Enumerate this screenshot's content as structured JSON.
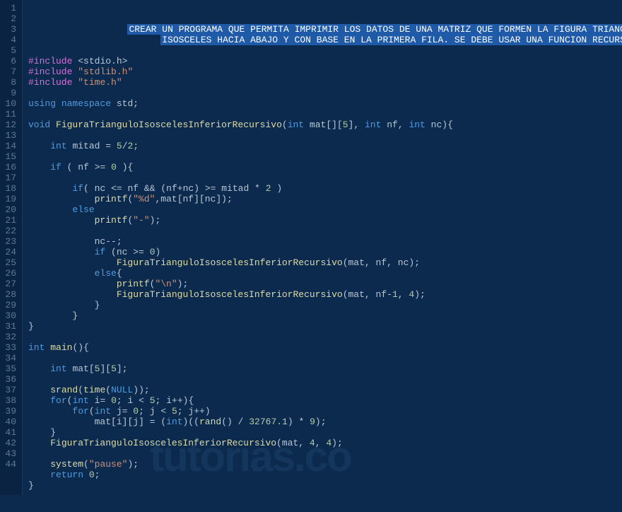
{
  "watermark": "tutorias.co",
  "gutter": [
    "1",
    "2",
    "3",
    "4",
    "5",
    "6",
    "7",
    "8",
    "9",
    "10",
    "11",
    "12",
    "13",
    "14",
    "15",
    "16",
    "17",
    "18",
    "19",
    "20",
    "21",
    "22",
    "23",
    "24",
    "25",
    "26",
    "27",
    "28",
    "29",
    "30",
    "31",
    "32",
    "33",
    "34",
    "35",
    "36",
    "37",
    "38",
    "39",
    "40",
    "41",
    "42",
    "43",
    "44"
  ],
  "lines": [
    {
      "type": "sel",
      "indent": "                  ",
      "text": "CREAR·UN·PROGRAMA·QUE·PERMITA·IMPRIMIR·LOS·DATOS·DE·UNA·MATRIZ·QUE·FORMEN·LA·FIGURA·TRIANGULO"
    },
    {
      "type": "sel",
      "indent": "                        ",
      "text": "ISOSCELES·HACIA·ABAJO·Y·CON·BASE·EN·LA·PRIMERA·FILA.·SE·DEBE·USAR·UNA·FUNCION·RECURSIVA"
    },
    {
      "type": "blank"
    },
    {
      "type": "include",
      "header": "<stdio.h>",
      "angle": true
    },
    {
      "type": "include",
      "header": "\"stdlib.h\"",
      "angle": false
    },
    {
      "type": "include",
      "header": "\"time.h\"",
      "angle": false
    },
    {
      "type": "blank"
    },
    {
      "type": "code",
      "tokens": [
        [
          "keyword",
          "using"
        ],
        [
          "ws",
          " "
        ],
        [
          "keyword",
          "namespace"
        ],
        [
          "ws",
          " "
        ],
        [
          "ident",
          "std"
        ],
        [
          "op",
          ";"
        ]
      ]
    },
    {
      "type": "blank"
    },
    {
      "type": "code",
      "tokens": [
        [
          "keyword",
          "void"
        ],
        [
          "ws",
          " "
        ],
        [
          "func",
          "FiguraTrianguloIsoscelesInferiorRecursivo"
        ],
        [
          "paren",
          "("
        ],
        [
          "keyword",
          "int"
        ],
        [
          "ws",
          " "
        ],
        [
          "ident",
          "mat"
        ],
        [
          "paren",
          "[]["
        ],
        [
          "num",
          "5"
        ],
        [
          "paren",
          "]"
        ],
        [
          "op",
          ","
        ],
        [
          "ws",
          " "
        ],
        [
          "keyword",
          "int"
        ],
        [
          "ws",
          " "
        ],
        [
          "ident",
          "nf"
        ],
        [
          "op",
          ","
        ],
        [
          "ws",
          " "
        ],
        [
          "keyword",
          "int"
        ],
        [
          "ws",
          " "
        ],
        [
          "ident",
          "nc"
        ],
        [
          "paren",
          ")"
        ],
        [
          "paren",
          "{"
        ]
      ]
    },
    {
      "type": "blank"
    },
    {
      "type": "code",
      "indent": "    ",
      "tokens": [
        [
          "keyword",
          "int"
        ],
        [
          "ws",
          " "
        ],
        [
          "ident",
          "mitad"
        ],
        [
          "ws",
          " "
        ],
        [
          "op",
          "="
        ],
        [
          "ws",
          " "
        ],
        [
          "num",
          "5"
        ],
        [
          "op",
          "/"
        ],
        [
          "num",
          "2"
        ],
        [
          "op",
          ";"
        ]
      ]
    },
    {
      "type": "blank"
    },
    {
      "type": "code",
      "indent": "    ",
      "tokens": [
        [
          "keyword",
          "if"
        ],
        [
          "ws",
          " "
        ],
        [
          "paren",
          "("
        ],
        [
          "ws",
          " "
        ],
        [
          "ident",
          "nf"
        ],
        [
          "ws",
          " "
        ],
        [
          "op",
          ">="
        ],
        [
          "ws",
          " "
        ],
        [
          "num",
          "0"
        ],
        [
          "ws",
          " "
        ],
        [
          "paren",
          ")"
        ],
        [
          "paren",
          "{"
        ]
      ]
    },
    {
      "type": "blank"
    },
    {
      "type": "code",
      "indent": "        ",
      "tokens": [
        [
          "keyword",
          "if"
        ],
        [
          "paren",
          "("
        ],
        [
          "ws",
          " "
        ],
        [
          "ident",
          "nc"
        ],
        [
          "ws",
          " "
        ],
        [
          "op",
          "<="
        ],
        [
          "ws",
          " "
        ],
        [
          "ident",
          "nf"
        ],
        [
          "ws",
          " "
        ],
        [
          "op",
          "&&"
        ],
        [
          "ws",
          " "
        ],
        [
          "paren",
          "("
        ],
        [
          "ident",
          "nf"
        ],
        [
          "op",
          "+"
        ],
        [
          "ident",
          "nc"
        ],
        [
          "paren",
          ")"
        ],
        [
          "ws",
          " "
        ],
        [
          "op",
          ">="
        ],
        [
          "ws",
          " "
        ],
        [
          "ident",
          "mitad"
        ],
        [
          "ws",
          " "
        ],
        [
          "op",
          "*"
        ],
        [
          "ws",
          " "
        ],
        [
          "num",
          "2"
        ],
        [
          "ws",
          " "
        ],
        [
          "paren",
          ")"
        ]
      ]
    },
    {
      "type": "code",
      "indent": "            ",
      "tokens": [
        [
          "func",
          "printf"
        ],
        [
          "paren",
          "("
        ],
        [
          "string",
          "\"%d\""
        ],
        [
          "op",
          ","
        ],
        [
          "ident",
          "mat"
        ],
        [
          "paren",
          "["
        ],
        [
          "ident",
          "nf"
        ],
        [
          "paren",
          "]["
        ],
        [
          "ident",
          "nc"
        ],
        [
          "paren",
          "]"
        ],
        [
          "paren",
          ")"
        ],
        [
          "op",
          ";"
        ]
      ]
    },
    {
      "type": "code",
      "indent": "        ",
      "tokens": [
        [
          "keyword",
          "else"
        ]
      ]
    },
    {
      "type": "code",
      "indent": "            ",
      "tokens": [
        [
          "func",
          "printf"
        ],
        [
          "paren",
          "("
        ],
        [
          "string",
          "\"-\""
        ],
        [
          "paren",
          ")"
        ],
        [
          "op",
          ";"
        ]
      ]
    },
    {
      "type": "blank"
    },
    {
      "type": "code",
      "indent": "            ",
      "tokens": [
        [
          "ident",
          "nc"
        ],
        [
          "op",
          "--"
        ],
        [
          "op",
          ";"
        ]
      ]
    },
    {
      "type": "code",
      "indent": "            ",
      "tokens": [
        [
          "keyword",
          "if"
        ],
        [
          "ws",
          " "
        ],
        [
          "paren",
          "("
        ],
        [
          "ident",
          "nc"
        ],
        [
          "ws",
          " "
        ],
        [
          "op",
          ">="
        ],
        [
          "ws",
          " "
        ],
        [
          "num",
          "0"
        ],
        [
          "paren",
          ")"
        ]
      ]
    },
    {
      "type": "code",
      "indent": "                ",
      "tokens": [
        [
          "func",
          "FiguraTrianguloIsoscelesInferiorRecursivo"
        ],
        [
          "paren",
          "("
        ],
        [
          "ident",
          "mat"
        ],
        [
          "op",
          ","
        ],
        [
          "ws",
          " "
        ],
        [
          "ident",
          "nf"
        ],
        [
          "op",
          ","
        ],
        [
          "ws",
          " "
        ],
        [
          "ident",
          "nc"
        ],
        [
          "paren",
          ")"
        ],
        [
          "op",
          ";"
        ]
      ]
    },
    {
      "type": "code",
      "indent": "            ",
      "tokens": [
        [
          "keyword",
          "else"
        ],
        [
          "paren",
          "{"
        ]
      ]
    },
    {
      "type": "code",
      "indent": "                ",
      "tokens": [
        [
          "func",
          "printf"
        ],
        [
          "paren",
          "("
        ],
        [
          "string",
          "\"\\n\""
        ],
        [
          "paren",
          ")"
        ],
        [
          "op",
          ";"
        ]
      ]
    },
    {
      "type": "code",
      "indent": "                ",
      "tokens": [
        [
          "func",
          "FiguraTrianguloIsoscelesInferiorRecursivo"
        ],
        [
          "paren",
          "("
        ],
        [
          "ident",
          "mat"
        ],
        [
          "op",
          ","
        ],
        [
          "ws",
          " "
        ],
        [
          "ident",
          "nf"
        ],
        [
          "op",
          "-"
        ],
        [
          "num",
          "1"
        ],
        [
          "op",
          ","
        ],
        [
          "ws",
          " "
        ],
        [
          "num",
          "4"
        ],
        [
          "paren",
          ")"
        ],
        [
          "op",
          ";"
        ]
      ]
    },
    {
      "type": "code",
      "indent": "            ",
      "tokens": [
        [
          "paren",
          "}"
        ]
      ]
    },
    {
      "type": "code",
      "indent": "        ",
      "tokens": [
        [
          "paren",
          "}"
        ]
      ]
    },
    {
      "type": "code",
      "tokens": [
        [
          "paren",
          "}"
        ]
      ]
    },
    {
      "type": "blank"
    },
    {
      "type": "code",
      "tokens": [
        [
          "keyword",
          "int"
        ],
        [
          "ws",
          " "
        ],
        [
          "func",
          "main"
        ],
        [
          "paren",
          "()"
        ],
        [
          "paren",
          "{"
        ]
      ]
    },
    {
      "type": "blank"
    },
    {
      "type": "code",
      "indent": "    ",
      "tokens": [
        [
          "keyword",
          "int"
        ],
        [
          "ws",
          " "
        ],
        [
          "ident",
          "mat"
        ],
        [
          "paren",
          "["
        ],
        [
          "num",
          "5"
        ],
        [
          "paren",
          "]["
        ],
        [
          "num",
          "5"
        ],
        [
          "paren",
          "]"
        ],
        [
          "op",
          ";"
        ]
      ]
    },
    {
      "type": "blank"
    },
    {
      "type": "code",
      "indent": "    ",
      "tokens": [
        [
          "func",
          "srand"
        ],
        [
          "paren",
          "("
        ],
        [
          "func",
          "time"
        ],
        [
          "paren",
          "("
        ],
        [
          "const",
          "NULL"
        ],
        [
          "paren",
          "))"
        ],
        [
          "op",
          ";"
        ]
      ]
    },
    {
      "type": "code",
      "indent": "    ",
      "tokens": [
        [
          "keyword",
          "for"
        ],
        [
          "paren",
          "("
        ],
        [
          "keyword",
          "int"
        ],
        [
          "ws",
          " "
        ],
        [
          "ident",
          "i"
        ],
        [
          "op",
          "="
        ],
        [
          "ws",
          " "
        ],
        [
          "num",
          "0"
        ],
        [
          "op",
          ";"
        ],
        [
          "ws",
          " "
        ],
        [
          "ident",
          "i"
        ],
        [
          "ws",
          " "
        ],
        [
          "op",
          "<"
        ],
        [
          "ws",
          " "
        ],
        [
          "num",
          "5"
        ],
        [
          "op",
          ";"
        ],
        [
          "ws",
          " "
        ],
        [
          "ident",
          "i"
        ],
        [
          "op",
          "++"
        ],
        [
          "paren",
          ")"
        ],
        [
          "paren",
          "{"
        ]
      ]
    },
    {
      "type": "code",
      "indent": "        ",
      "tokens": [
        [
          "keyword",
          "for"
        ],
        [
          "paren",
          "("
        ],
        [
          "keyword",
          "int"
        ],
        [
          "ws",
          " "
        ],
        [
          "ident",
          "j"
        ],
        [
          "op",
          "="
        ],
        [
          "ws",
          " "
        ],
        [
          "num",
          "0"
        ],
        [
          "op",
          ";"
        ],
        [
          "ws",
          " "
        ],
        [
          "ident",
          "j"
        ],
        [
          "ws",
          " "
        ],
        [
          "op",
          "<"
        ],
        [
          "ws",
          " "
        ],
        [
          "num",
          "5"
        ],
        [
          "op",
          ";"
        ],
        [
          "ws",
          " "
        ],
        [
          "ident",
          "j"
        ],
        [
          "op",
          "++"
        ],
        [
          "paren",
          ")"
        ]
      ]
    },
    {
      "type": "code",
      "indent": "            ",
      "tokens": [
        [
          "ident",
          "mat"
        ],
        [
          "paren",
          "["
        ],
        [
          "ident",
          "i"
        ],
        [
          "paren",
          "]["
        ],
        [
          "ident",
          "j"
        ],
        [
          "paren",
          "]"
        ],
        [
          "ws",
          " "
        ],
        [
          "op",
          "="
        ],
        [
          "ws",
          " "
        ],
        [
          "paren",
          "("
        ],
        [
          "keyword",
          "int"
        ],
        [
          "paren",
          ")"
        ],
        [
          "paren",
          "(("
        ],
        [
          "func",
          "rand"
        ],
        [
          "paren",
          "()"
        ],
        [
          "ws",
          " "
        ],
        [
          "op",
          "/"
        ],
        [
          "ws",
          " "
        ],
        [
          "num",
          "32767.1"
        ],
        [
          "paren",
          ")"
        ],
        [
          "ws",
          " "
        ],
        [
          "op",
          "*"
        ],
        [
          "ws",
          " "
        ],
        [
          "num",
          "9"
        ],
        [
          "paren",
          ")"
        ],
        [
          "op",
          ";"
        ]
      ]
    },
    {
      "type": "code",
      "indent": "    ",
      "tokens": [
        [
          "paren",
          "}"
        ]
      ]
    },
    {
      "type": "code",
      "indent": "    ",
      "tokens": [
        [
          "func",
          "FiguraTrianguloIsoscelesInferiorRecursivo"
        ],
        [
          "paren",
          "("
        ],
        [
          "ident",
          "mat"
        ],
        [
          "op",
          ","
        ],
        [
          "ws",
          " "
        ],
        [
          "num",
          "4"
        ],
        [
          "op",
          ","
        ],
        [
          "ws",
          " "
        ],
        [
          "num",
          "4"
        ],
        [
          "paren",
          ")"
        ],
        [
          "op",
          ";"
        ]
      ]
    },
    {
      "type": "blank"
    },
    {
      "type": "code",
      "indent": "    ",
      "tokens": [
        [
          "func",
          "system"
        ],
        [
          "paren",
          "("
        ],
        [
          "string",
          "\"pause\""
        ],
        [
          "paren",
          ")"
        ],
        [
          "op",
          ";"
        ]
      ]
    },
    {
      "type": "code",
      "indent": "    ",
      "tokens": [
        [
          "keyword",
          "return"
        ],
        [
          "ws",
          " "
        ],
        [
          "num",
          "0"
        ],
        [
          "op",
          ";"
        ]
      ]
    },
    {
      "type": "code",
      "tokens": [
        [
          "paren",
          "}"
        ]
      ]
    }
  ]
}
